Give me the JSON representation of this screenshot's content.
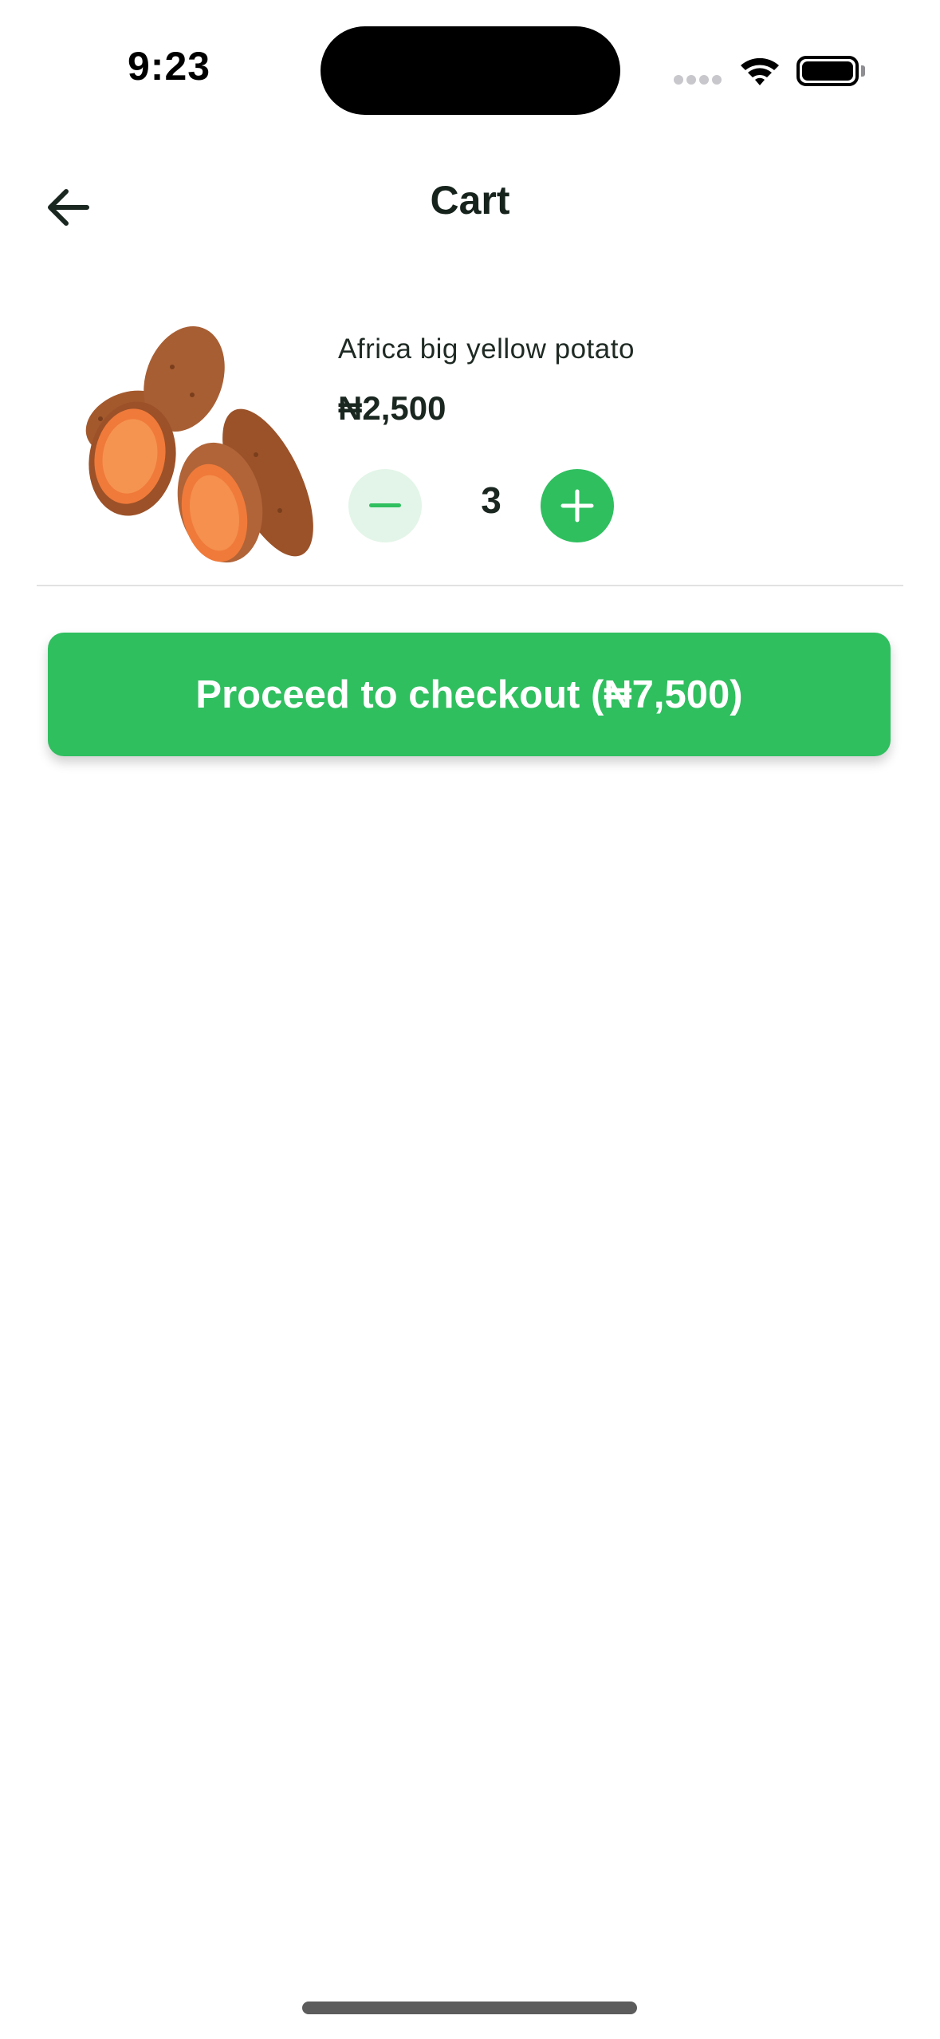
{
  "status_bar": {
    "time": "9:23"
  },
  "header": {
    "title": "Cart"
  },
  "cart": {
    "items": [
      {
        "name": "Africa big yellow potato",
        "price": "₦2,500",
        "quantity": "3"
      }
    ]
  },
  "checkout": {
    "label": "Proceed to checkout (₦7,500)"
  },
  "colors": {
    "accent": "#2fbf5f",
    "accent_light": "#e3f5e8",
    "text_dark": "#1a2620"
  },
  "icons": [
    "back-arrow-icon",
    "minus-icon",
    "plus-icon",
    "wifi-icon",
    "battery-icon",
    "signal-icon"
  ]
}
